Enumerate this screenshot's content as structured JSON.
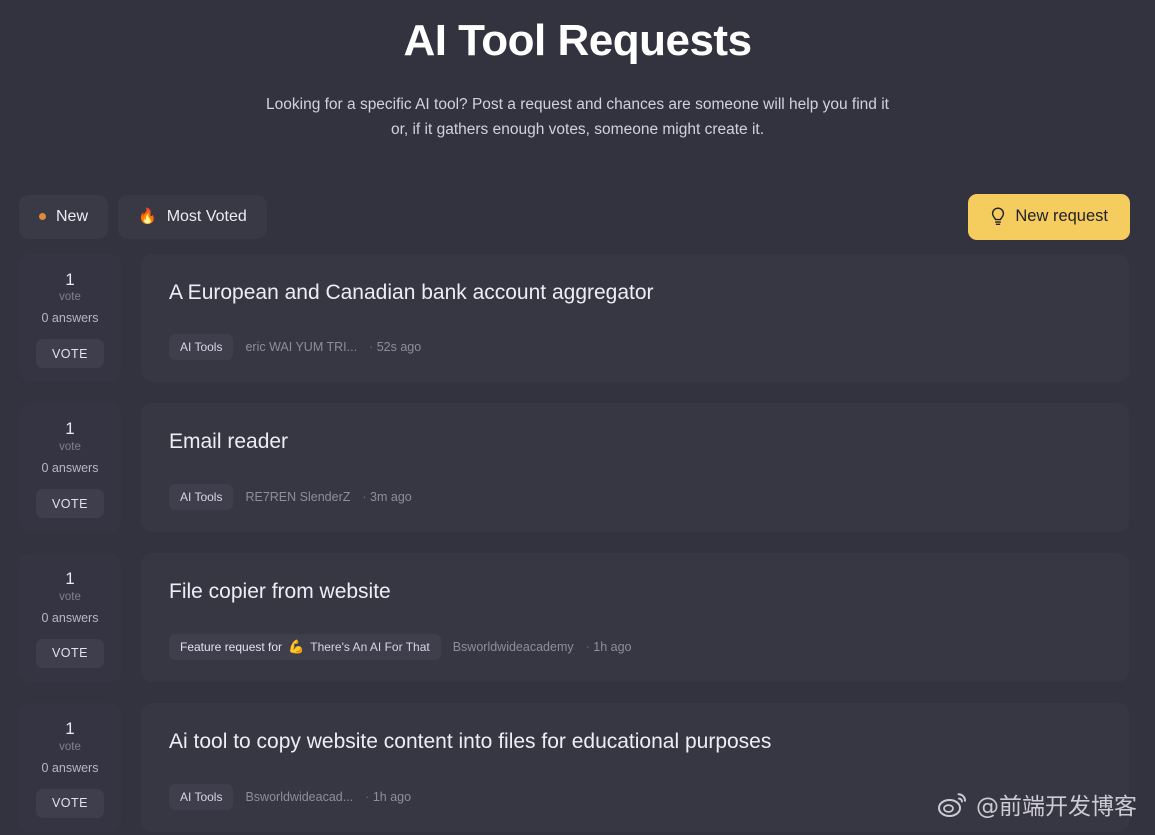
{
  "header": {
    "title": "AI Tool Requests",
    "subtitle": "Looking for a specific AI tool? Post a request and chances are someone will help you find it or, if it gathers enough votes, someone might create it."
  },
  "toolbar": {
    "tabs": [
      {
        "label": "New",
        "icon": "orange-dot-icon",
        "active": true
      },
      {
        "label": "Most Voted",
        "icon": "fire-icon",
        "active": false
      }
    ],
    "new_request_label": "New request",
    "new_request_icon": "lightbulb-icon"
  },
  "labels": {
    "vote_singular": "vote",
    "vote_button": "VOTE",
    "meta_separator": "·"
  },
  "colors": {
    "page_background": "#33323f",
    "card_background": "#373643",
    "vote_panel_background": "#353442",
    "accent_button": "#f5cd5f",
    "badge_background": "#3f3e4d",
    "new_dot": "#e08b3a"
  },
  "requests": [
    {
      "votes": "1",
      "vote_label": "vote",
      "answers": "0 answers",
      "vote_button": "VOTE",
      "title": "A European and Canadian bank account aggregator",
      "badge": {
        "prefix": "",
        "icon": "",
        "label": "AI Tools"
      },
      "author": "eric WAI YUM TRI...",
      "time": "52s ago"
    },
    {
      "votes": "1",
      "vote_label": "vote",
      "answers": "0 answers",
      "vote_button": "VOTE",
      "title": "Email reader",
      "badge": {
        "prefix": "",
        "icon": "",
        "label": "AI Tools"
      },
      "author": "RE7REN SlenderZ",
      "time": "3m ago"
    },
    {
      "votes": "1",
      "vote_label": "vote",
      "answers": "0 answers",
      "vote_button": "VOTE",
      "title": "File copier from website",
      "badge": {
        "prefix": "Feature request for",
        "icon": "💪",
        "label": "There's An AI For That"
      },
      "author": "Bsworldwideacademy",
      "time": "1h ago"
    },
    {
      "votes": "1",
      "vote_label": "vote",
      "answers": "0 answers",
      "vote_button": "VOTE",
      "title": "Ai tool to copy website content into files for educational purposes",
      "badge": {
        "prefix": "",
        "icon": "",
        "label": "AI Tools"
      },
      "author": "Bsworldwideacad...",
      "time": "1h ago"
    }
  ],
  "watermark": {
    "text": "@前端开发博客",
    "icon": "weibo-icon"
  }
}
